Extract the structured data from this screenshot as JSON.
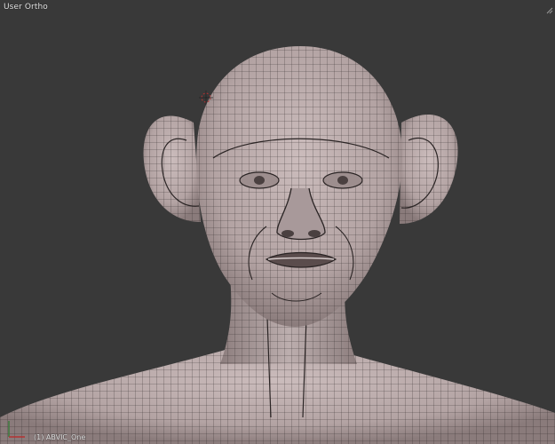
{
  "viewport": {
    "view_name": "User Ortho",
    "active_object": "(1) ABVIC_One",
    "colors": {
      "background": "#393939",
      "mesh_fill": "#b9a9a9",
      "mesh_shadow": "#7d6f6f",
      "wire": "#2a2424",
      "text": "#e6e6e6"
    },
    "icons": {
      "corner": "corner-resize-icon",
      "gizmo": "axis-gizmo-icon",
      "cursor": "3d-cursor-icon"
    }
  }
}
